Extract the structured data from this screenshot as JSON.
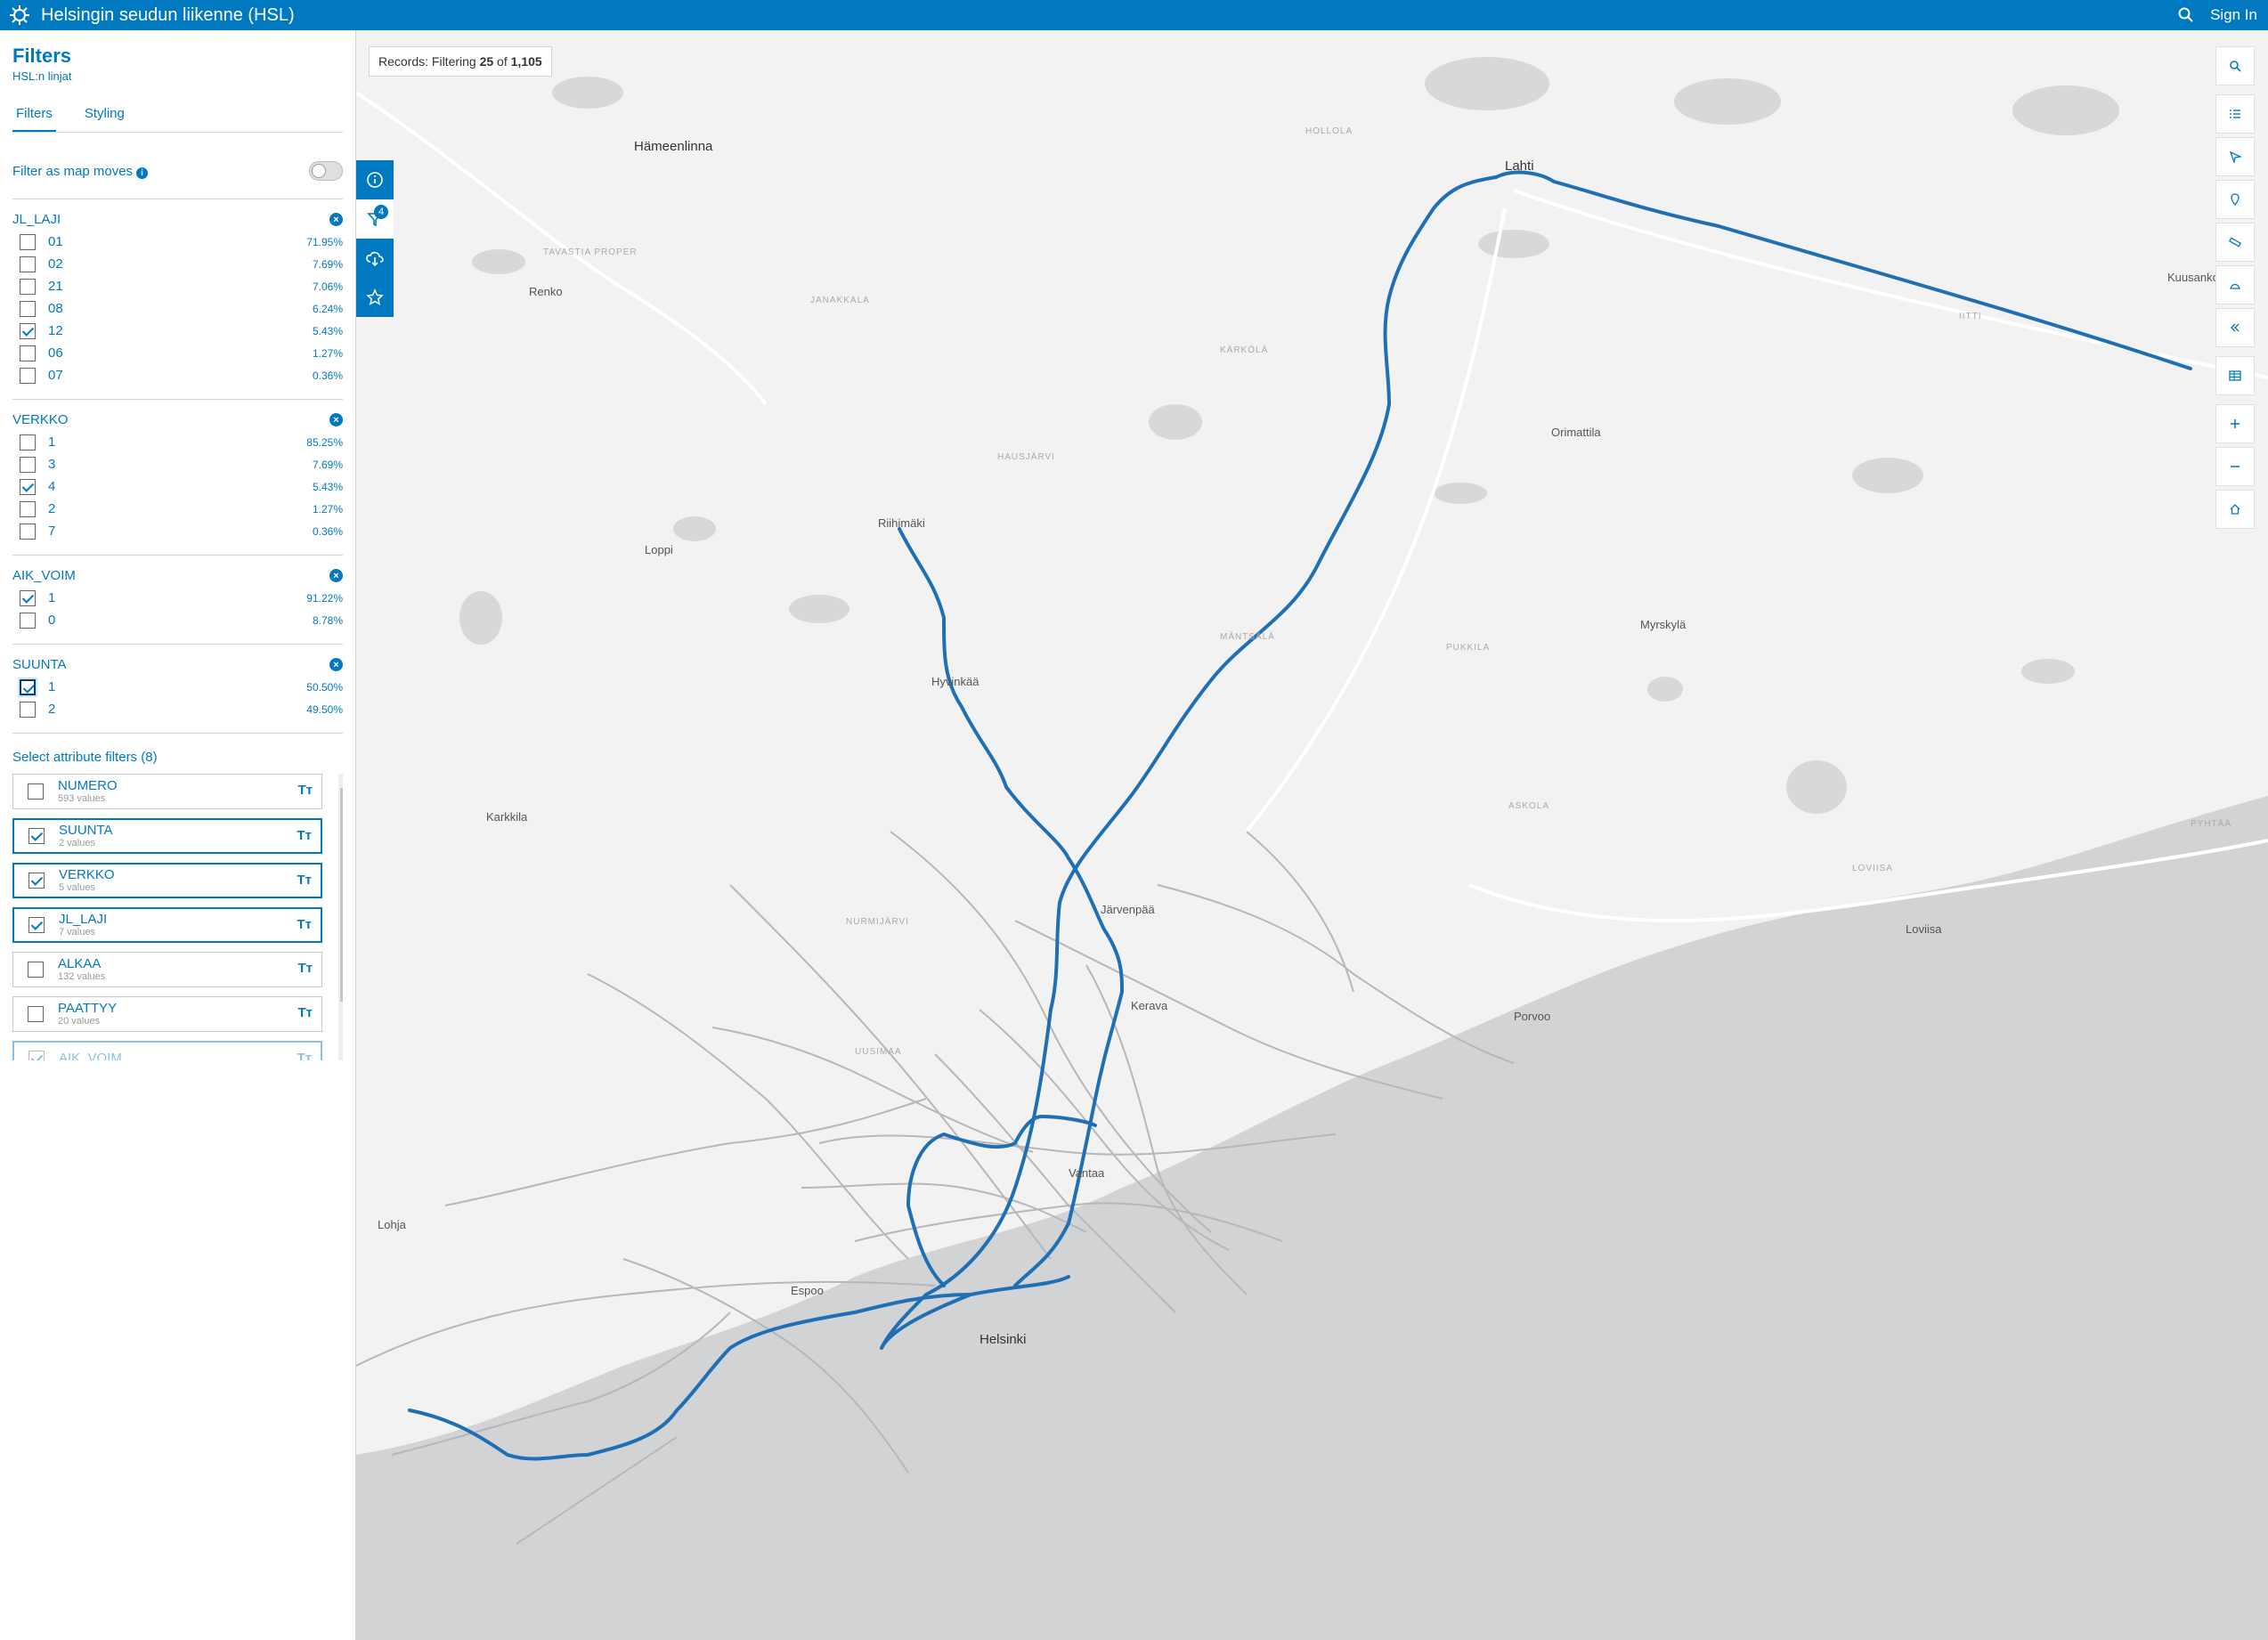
{
  "app": {
    "title": "Helsingin seudun liikenne (HSL)",
    "sign_in": "Sign In"
  },
  "panel": {
    "title": "Filters",
    "subtitle": "HSL:n linjat",
    "tabs": [
      "Filters",
      "Styling"
    ],
    "filter_as_map_moves": "Filter as map moves",
    "groups": [
      {
        "name": "JL_LAJI",
        "items": [
          {
            "label": "01",
            "pct": "71.95%",
            "checked": false
          },
          {
            "label": "02",
            "pct": "7.69%",
            "checked": false
          },
          {
            "label": "21",
            "pct": "7.06%",
            "checked": false
          },
          {
            "label": "08",
            "pct": "6.24%",
            "checked": false
          },
          {
            "label": "12",
            "pct": "5.43%",
            "checked": true
          },
          {
            "label": "06",
            "pct": "1.27%",
            "checked": false
          },
          {
            "label": "07",
            "pct": "0.36%",
            "checked": false
          }
        ]
      },
      {
        "name": "VERKKO",
        "items": [
          {
            "label": "1",
            "pct": "85.25%",
            "checked": false
          },
          {
            "label": "3",
            "pct": "7.69%",
            "checked": false
          },
          {
            "label": "4",
            "pct": "5.43%",
            "checked": true
          },
          {
            "label": "2",
            "pct": "1.27%",
            "checked": false
          },
          {
            "label": "7",
            "pct": "0.36%",
            "checked": false
          }
        ]
      },
      {
        "name": "AIK_VOIM",
        "items": [
          {
            "label": "1",
            "pct": "91.22%",
            "checked": true
          },
          {
            "label": "0",
            "pct": "8.78%",
            "checked": false
          }
        ]
      },
      {
        "name": "SUUNTA",
        "items": [
          {
            "label": "1",
            "pct": "50.50%",
            "checked": true
          },
          {
            "label": "2",
            "pct": "49.50%",
            "checked": false
          }
        ]
      }
    ],
    "attr_title": "Select attribute filters (8)",
    "attributes": [
      {
        "name": "NUMERO",
        "values": "593 values",
        "checked": false
      },
      {
        "name": "SUUNTA",
        "values": "2 values",
        "checked": true
      },
      {
        "name": "VERKKO",
        "values": "5 values",
        "checked": true
      },
      {
        "name": "JL_LAJI",
        "values": "7 values",
        "checked": true
      },
      {
        "name": "ALKAA",
        "values": "132 values",
        "checked": false
      },
      {
        "name": "PAATTYY",
        "values": "20 values",
        "checked": false
      },
      {
        "name": "AIK_VOIM",
        "values": "",
        "checked": true
      }
    ],
    "attr_type_icon": "Tт"
  },
  "map": {
    "records_prefix": "Records: Filtering ",
    "records_count": "25",
    "records_of": " of ",
    "records_total": "1,105",
    "filter_badge": "4",
    "places": {
      "hameenlinna": "Hämeenlinna",
      "lahti": "Lahti",
      "riihimaki": "Riihimäki",
      "hyvinkaa": "Hyvinkää",
      "jarvenpaa": "Järvenpää",
      "kerava": "Kerava",
      "vantaa": "Vantaa",
      "helsinki": "Helsinki",
      "porvoo": "Porvoo",
      "loviisa": "Loviisa",
      "lohja": "Lohja",
      "karkkila": "Karkkila",
      "loppi": "Loppi",
      "renko": "Renko",
      "orimattila": "Orimattila",
      "myrskyla": "Myrskylä",
      "kuusankoski": "Kuusankoski",
      "espoo": "Espoo"
    },
    "regions": {
      "tavastia": "TAVASTIA PROPER",
      "janakkala": "JANAKKALA",
      "hollola": "HOLLOLA",
      "karkola": "KÄRKÖLÄ",
      "hausjarvi": "HAUSJÄRVI",
      "mantsala": "MÄNTSÄLÄ",
      "pukkila": "PUKKILA",
      "askola": "ASKOLA",
      "nurmijarvi": "NURMIJÄRVI",
      "uusimaa": "UUSIMAA",
      "loviisa_r": "LOVIISA",
      "iitti": "IITTI",
      "pyhtaa": "PYHTÄÄ"
    }
  }
}
